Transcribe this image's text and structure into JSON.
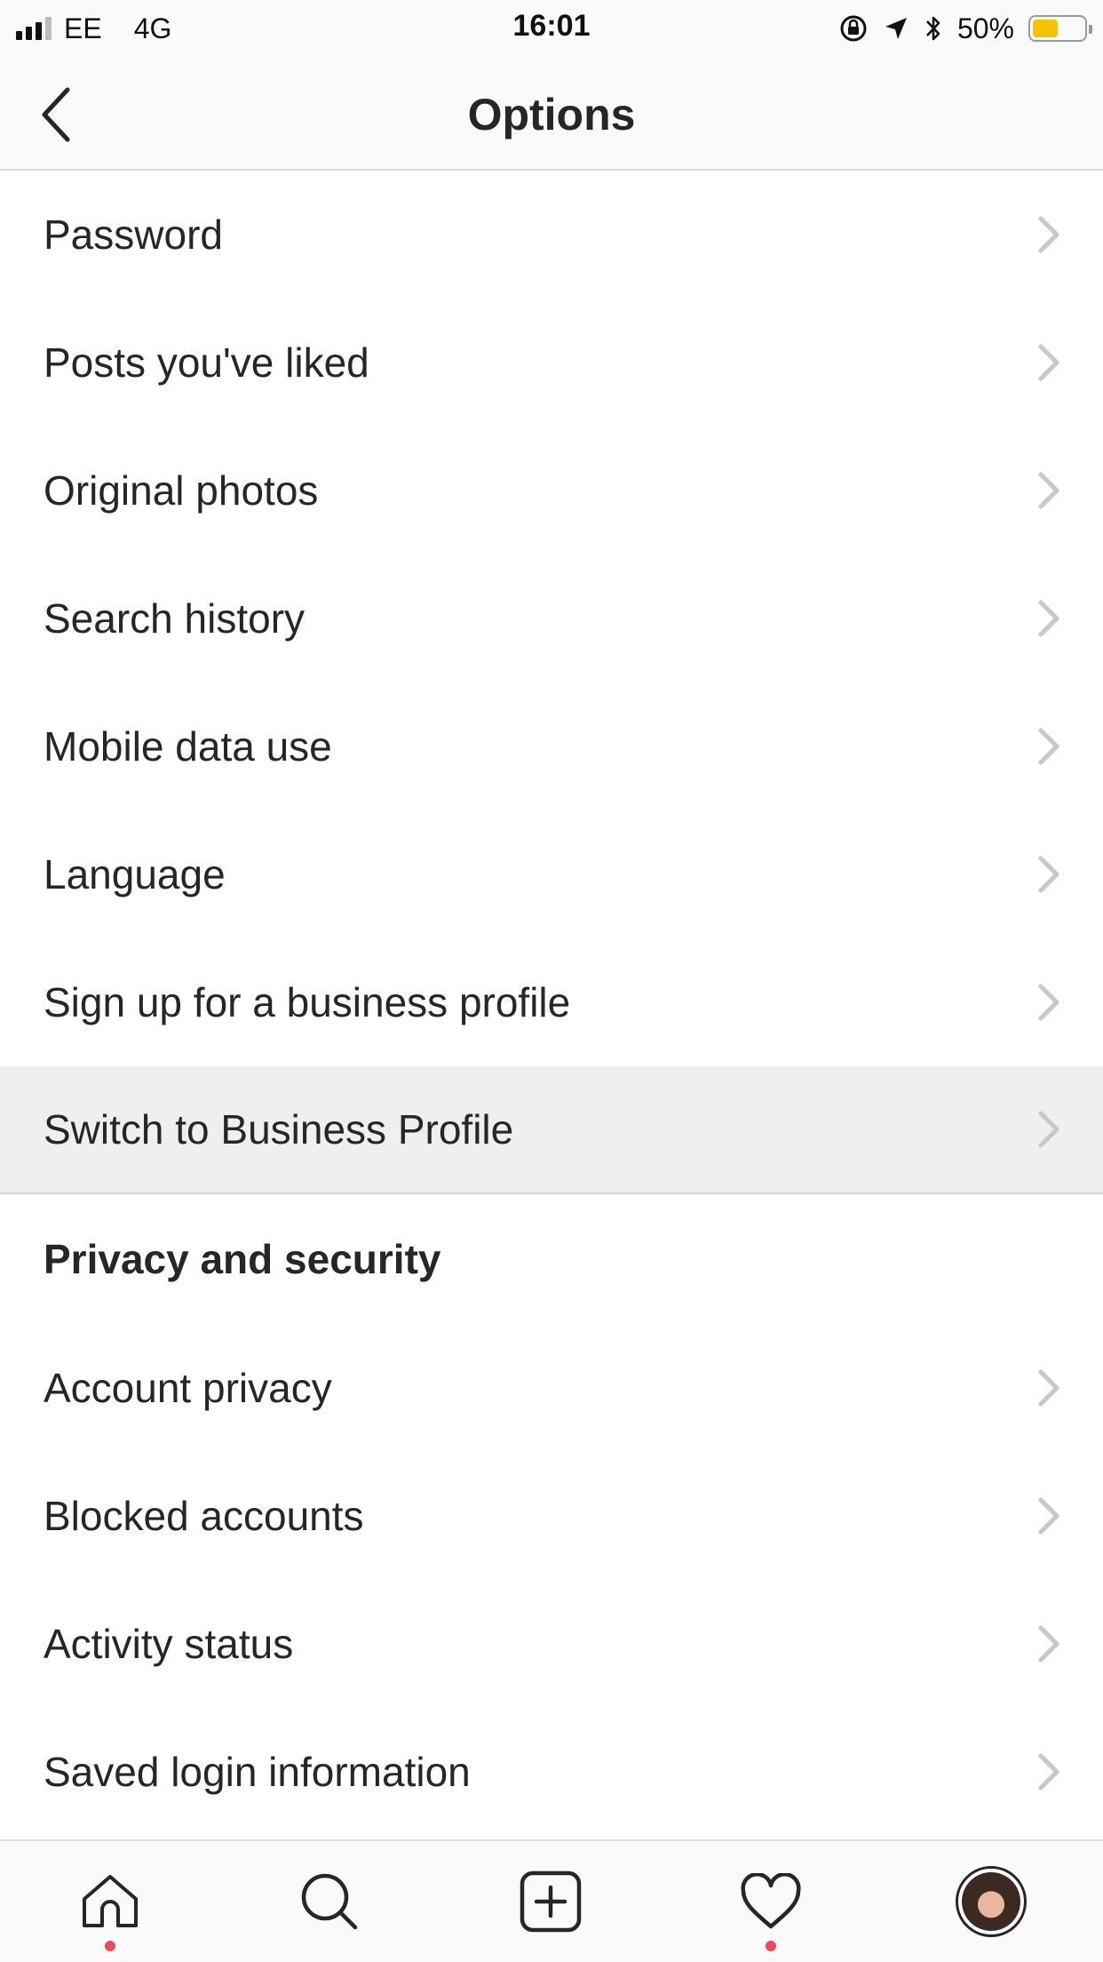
{
  "status_bar": {
    "carrier": "EE",
    "network": "4G",
    "time": "16:01",
    "battery_percent": "50%",
    "battery_level": 0.5,
    "signal_bars_active": 3,
    "signal_bars_total": 4,
    "icons": [
      "orientation-lock-icon",
      "location-arrow-icon",
      "bluetooth-icon",
      "battery-icon"
    ],
    "battery_color": "#f5c400"
  },
  "nav": {
    "title": "Options",
    "back_icon": "chevron-left-icon"
  },
  "account_items": [
    {
      "label": "Password"
    },
    {
      "label": "Posts you've liked"
    },
    {
      "label": "Original photos"
    },
    {
      "label": "Search history"
    },
    {
      "label": "Mobile data use"
    },
    {
      "label": "Language"
    },
    {
      "label": "Sign up for a business profile"
    },
    {
      "label": "Switch to Business Profile",
      "highlighted": true
    }
  ],
  "privacy_section": {
    "title": "Privacy and security",
    "items": [
      {
        "label": "Account privacy"
      },
      {
        "label": "Blocked accounts"
      },
      {
        "label": "Activity status"
      },
      {
        "label": "Saved login information"
      }
    ]
  },
  "tab_bar": {
    "tabs": [
      {
        "icon": "home-icon",
        "notification_dot": true
      },
      {
        "icon": "search-icon",
        "notification_dot": false
      },
      {
        "icon": "add-post-icon",
        "notification_dot": false
      },
      {
        "icon": "heart-icon",
        "notification_dot": true
      },
      {
        "icon": "profile-avatar",
        "notification_dot": false
      }
    ],
    "dot_color": "#ed4956"
  }
}
